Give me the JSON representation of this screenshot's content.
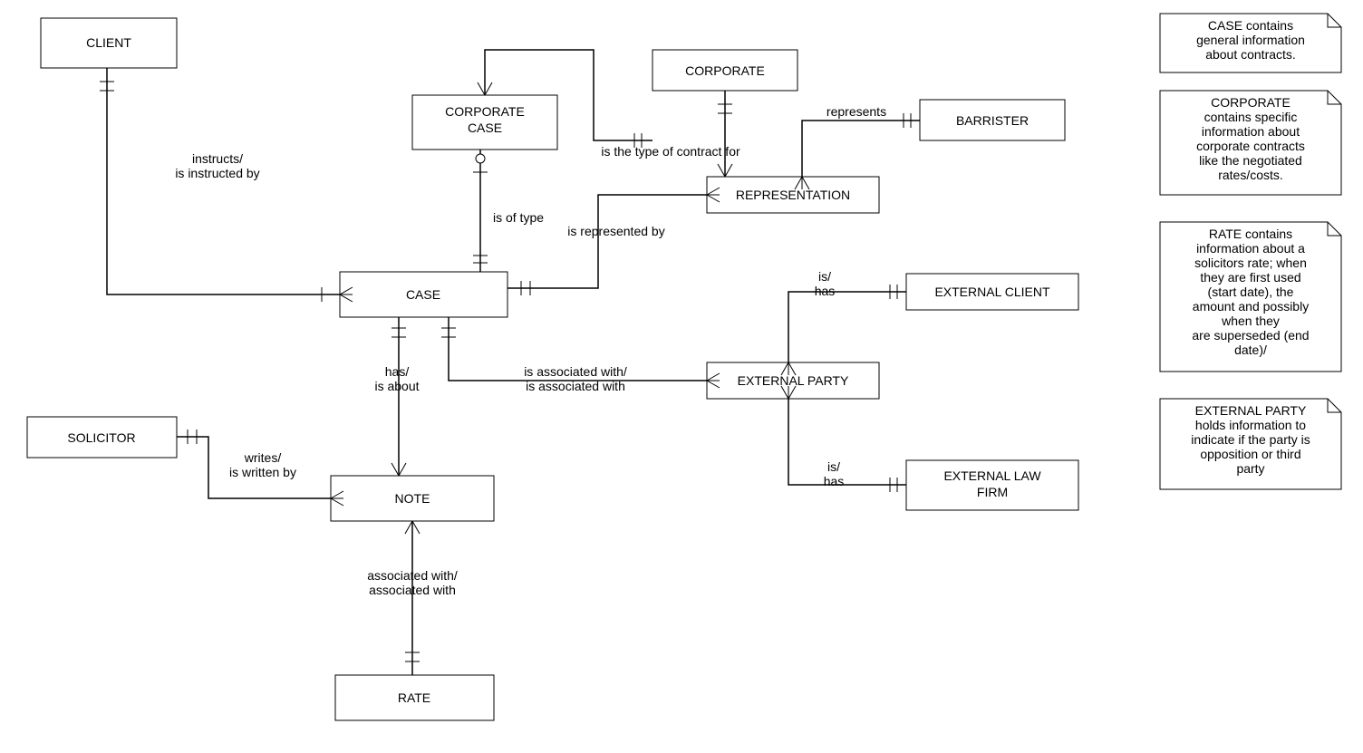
{
  "entities": {
    "client": "CLIENT",
    "corporate_case": "CORPORATE\nCASE",
    "corporate": "CORPORATE",
    "barrister": "BARRISTER",
    "representation": "REPRESENTATION",
    "case": "CASE",
    "external_client": "EXTERNAL CLIENT",
    "external_party": "EXTERNAL PARTY",
    "solicitor": "SOLICITOR",
    "note": "NOTE",
    "external_law_firm": "EXTERNAL LAW\nFIRM",
    "rate": "RATE"
  },
  "labels": {
    "instructs": "instructs/\nis instructed by",
    "is_of_type": "is of type",
    "is_type_contract": "is the type of contract for",
    "represents": "represents",
    "is_represented_by": "is represented by",
    "is_has_top": "is/\nhas",
    "is_has_bottom": "is/\nhas",
    "has_is_about": "has/\nis about",
    "is_associated": "is associated with/\nis associated with",
    "writes": "writes/\nis written by",
    "associated_with": "associated with/\nassociated with"
  },
  "notes": {
    "n1": "CASE contains\ngeneral information\nabout contracts.",
    "n2": "CORPORATE\ncontains specific\ninformation about\ncorporate contracts\nlike the negotiated\nrates/costs.",
    "n3": "RATE contains\ninformation about a\nsolicitors rate; when\nthey are first used\n(start date), the\namount and possibly\nwhen they\nare superseded (end\ndate)/",
    "n4": "EXTERNAL PARTY\nholds information to\nindicate if the party is\nopposition or third\nparty"
  }
}
